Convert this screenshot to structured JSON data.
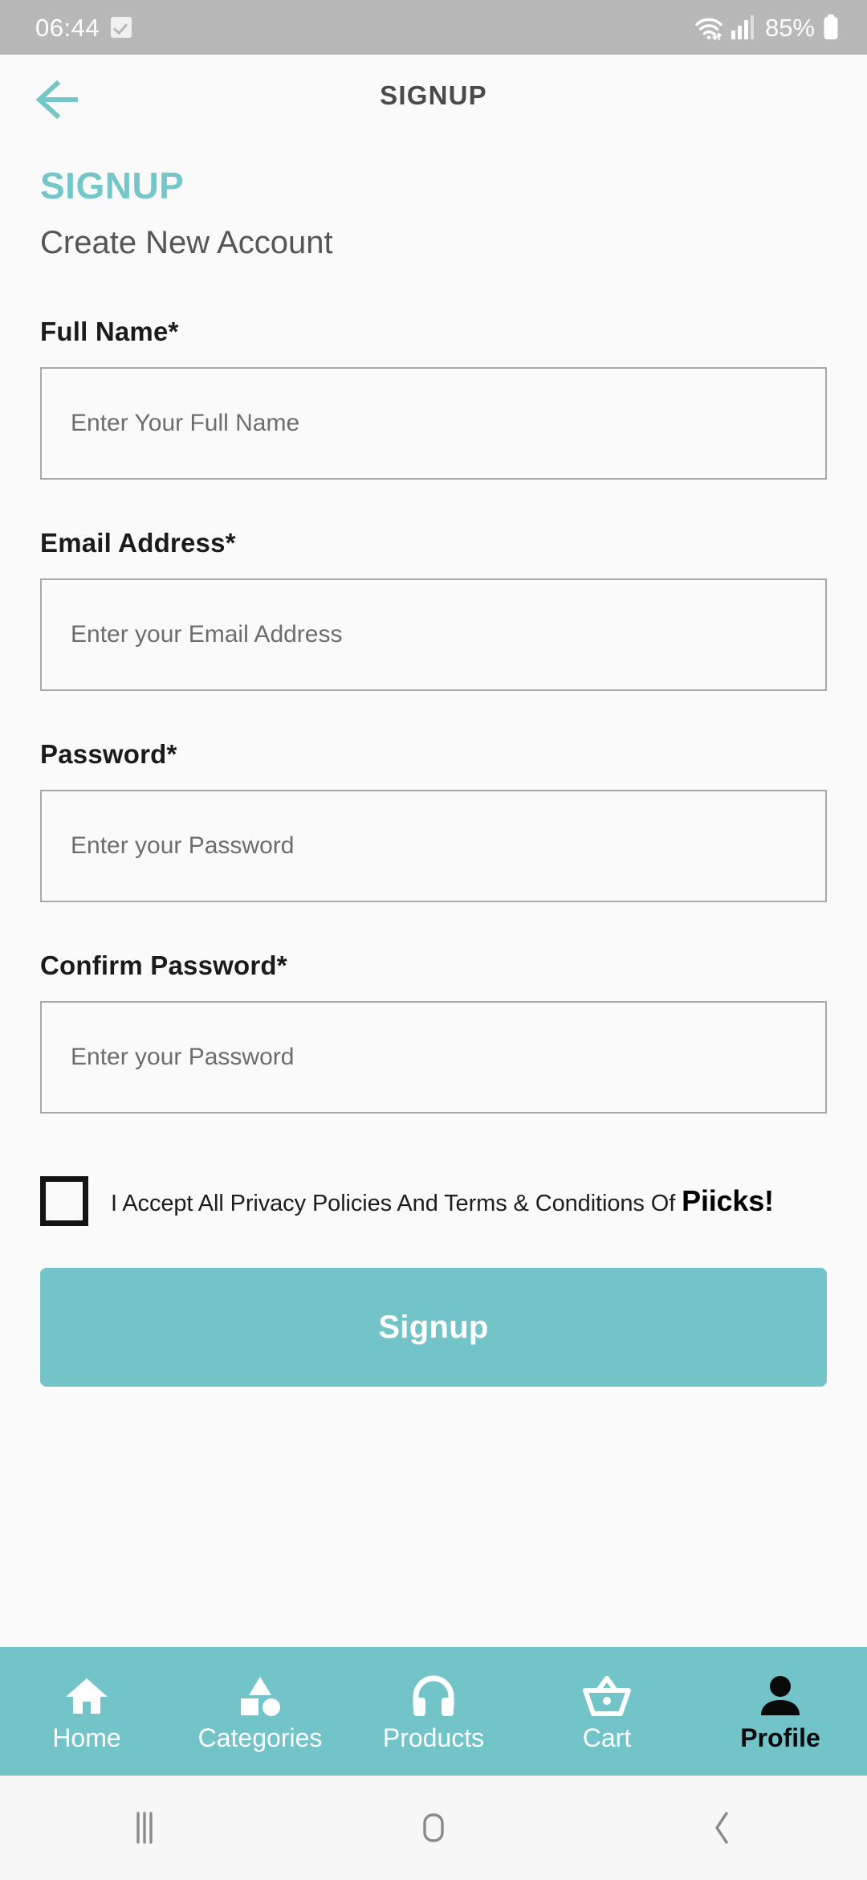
{
  "status_bar": {
    "time": "06:44",
    "check_icon": "checkbox-checked-icon",
    "wifi_icon": "wifi-icon",
    "signal_icon": "cellular-signal-icon",
    "battery_percent": "85%",
    "battery_icon": "battery-icon",
    "background_color": "#b8b8b8"
  },
  "app_bar": {
    "back_icon": "arrow-left-icon",
    "title": "SIGNUP"
  },
  "page": {
    "heading": "SIGNUP",
    "subtitle": "Create New Account",
    "accent_color": "#72c4c8"
  },
  "form": {
    "fields": [
      {
        "label": "Full Name*",
        "placeholder": "Enter Your Full Name",
        "value": "",
        "name": "full-name"
      },
      {
        "label": "Email Address*",
        "placeholder": "Enter your Email Address",
        "value": "",
        "name": "email-address"
      },
      {
        "label": "Password*",
        "placeholder": "Enter your Password",
        "value": "",
        "name": "password"
      },
      {
        "label": "Confirm Password*",
        "placeholder": "Enter your Password",
        "value": "",
        "name": "confirm-password"
      }
    ],
    "terms": {
      "checked": false,
      "text": "I Accept All Privacy Policies And Terms & Conditions Of",
      "brand": "Piicks!"
    },
    "submit_label": "Signup"
  },
  "bottom_nav": {
    "background_color": "#72c4c8",
    "active_index": 4,
    "items": [
      {
        "label": "Home",
        "icon": "home-icon"
      },
      {
        "label": "Categories",
        "icon": "shapes-categories-icon"
      },
      {
        "label": "Products",
        "icon": "headphones-icon"
      },
      {
        "label": "Cart",
        "icon": "basket-icon"
      },
      {
        "label": "Profile",
        "icon": "person-icon"
      }
    ]
  },
  "system_nav": {
    "recents_icon": "recents-bars-icon",
    "home_icon": "home-square-icon",
    "back_icon": "back-chevron-icon"
  }
}
